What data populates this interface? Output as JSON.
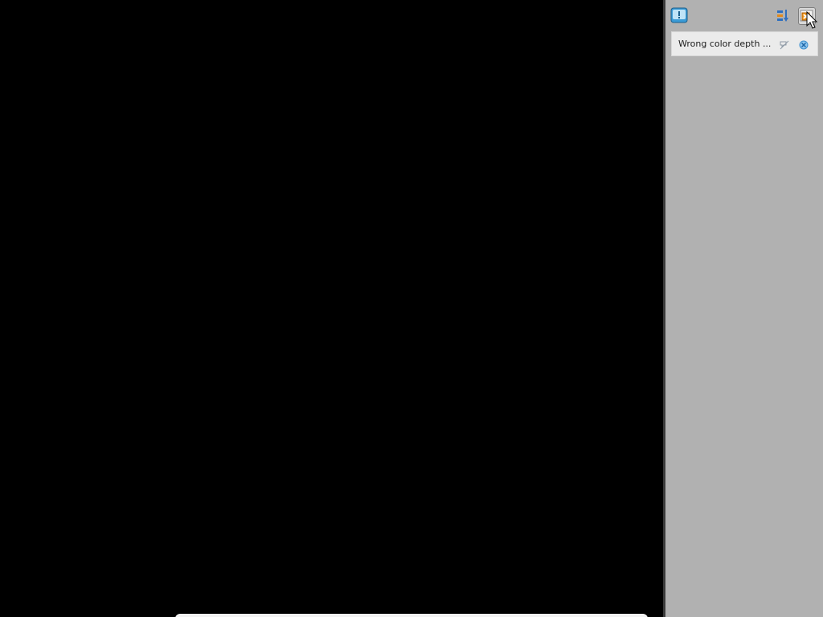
{
  "notification_center": {
    "toolbar": {
      "message_icon": "message-balloon-icon",
      "hide_icon": "hide-panel-icon",
      "close_all_icon": "close-all-icon"
    },
    "notifications": [
      {
        "text": "Wrong color depth ...",
        "mute_icon": "mute-icon",
        "dismiss_icon": "dismiss-icon"
      }
    ]
  },
  "colors": {
    "desktop": "#000000",
    "panel_background": "#b1b1b1",
    "notification_background": "#ebebeb",
    "accent": "#2f8fd8"
  }
}
